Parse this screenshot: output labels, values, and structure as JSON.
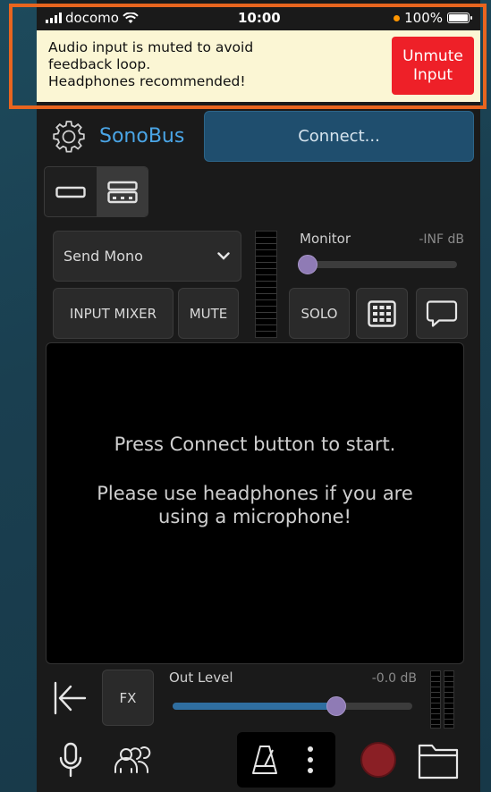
{
  "status_bar": {
    "carrier": "docomo",
    "time": "10:00",
    "battery": "100%"
  },
  "notification": {
    "message_line1": "Audio input is muted to avoid",
    "message_line2": "feedback loop.",
    "message_line3": "Headphones recommended!",
    "unmute_line1": "Unmute",
    "unmute_line2": "Input"
  },
  "header": {
    "app_name": "SonoBus",
    "connect_label": "Connect..."
  },
  "controls": {
    "send_mode": "Send Mono",
    "input_mixer_label": "INPUT MIXER",
    "mute_label": "MUTE",
    "solo_label": "SOLO",
    "monitor_label": "Monitor",
    "monitor_db": "-INF dB",
    "monitor_level": 0.0
  },
  "panel": {
    "line1": "Press Connect button to start.",
    "line2": "Please use headphones if you are using a microphone!"
  },
  "bottom": {
    "fx_label": "FX",
    "out_level_label": "Out Level",
    "out_level_db": "-0.0 dB",
    "out_level": 0.7
  },
  "colors": {
    "accent_blue": "#4aa5e6",
    "connect_bg": "#1f4e6e",
    "unmute_red": "#ee2028",
    "knob_purple": "#8f7bb5",
    "record_red": "#8a1f25",
    "notification_bg": "#fbf6d4",
    "highlight_orange": "#e8651f"
  },
  "icons": {
    "settings": "gear-icon",
    "layout_single": "single-layout-icon",
    "layout_multi": "multi-layout-icon",
    "grid": "grid-icon",
    "chat": "chat-icon",
    "back": "back-arrow-icon",
    "mic": "microphone-icon",
    "users": "users-icon",
    "metronome": "metronome-icon",
    "more": "more-vertical-icon",
    "record": "record-icon",
    "folder": "folder-icon"
  }
}
